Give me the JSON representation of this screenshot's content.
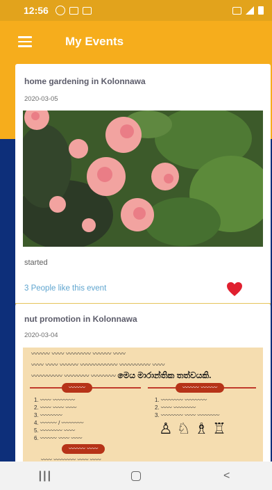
{
  "status_bar": {
    "time": "12:56"
  },
  "app_bar": {
    "title": "My Events",
    "menu_icon": "hamburger-menu-icon"
  },
  "events": [
    {
      "title": "home gardening  in Kolonnawa",
      "date": "2020-03-05",
      "image": "pink geranium flowers photo",
      "status": "started",
      "likes": "3 People like this event",
      "liked": true,
      "heart_color": "#e0202f"
    },
    {
      "title": "nut promotion  in Kolonnawa",
      "date": "2020-03-04",
      "image": "health awareness poster",
      "poster": {
        "highlight": "මෙය මාරාන්තික තත්වයකි."
      }
    }
  ],
  "colors": {
    "accent": "#f6ad1c",
    "background": "#0d2f7a",
    "link": "#5fa5cf"
  },
  "nav": {
    "recent_icon": "recent-apps-icon",
    "home_icon": "home-icon",
    "back_icon": "back-icon"
  }
}
